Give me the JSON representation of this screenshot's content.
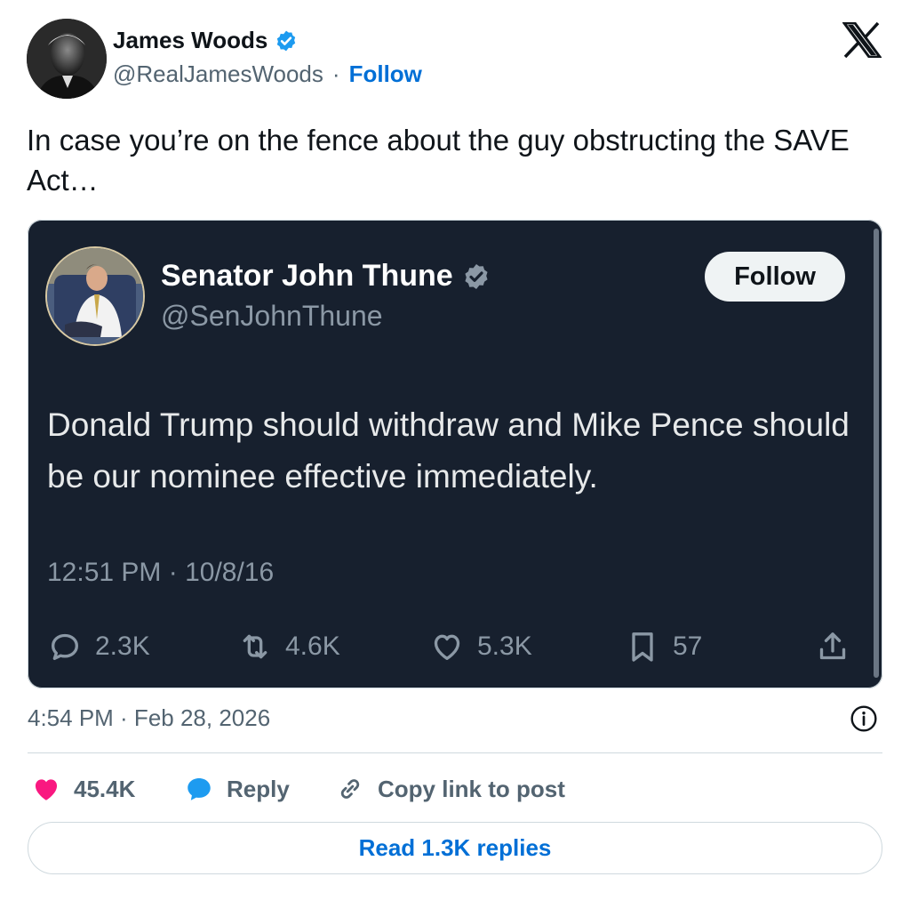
{
  "author": {
    "name": "James Woods",
    "handle": "@RealJamesWoods",
    "separator": "·",
    "follow_label": "Follow",
    "verified_icon": "verified-badge-icon",
    "avatar": "profile-photo"
  },
  "platform_logo": "x-logo-icon",
  "tweet": {
    "text": "In case you’re on the fence about the guy obstructing the SAVE Act…"
  },
  "embedded_post": {
    "author_name": "Senator John Thune",
    "author_handle": "@SenJohnThune",
    "verified_icon": "gray-verified-badge-icon",
    "follow_label": "Follow",
    "text": "Donald Trump should withdraw and Mike Pence should be our nominee effective immediately.",
    "timestamp": "12:51 PM · 10/8/16",
    "metrics": {
      "replies": "2.3K",
      "reposts": "4.6K",
      "likes": "5.3K",
      "bookmarks": "57"
    },
    "colors": {
      "background": "#17202e",
      "text": "#e7e9ea",
      "muted": "#8b98a5"
    }
  },
  "post_timestamp": "4:54 PM · Feb 28, 2026",
  "footer": {
    "likes_count": "45.4K",
    "reply_label": "Reply",
    "copy_link_label": "Copy link to post",
    "read_replies_label": "Read 1.3K replies"
  },
  "colors": {
    "link": "#006fd6",
    "like": "#f91880",
    "reply": "#1d9bf0",
    "verified": "#1d9bf0"
  }
}
